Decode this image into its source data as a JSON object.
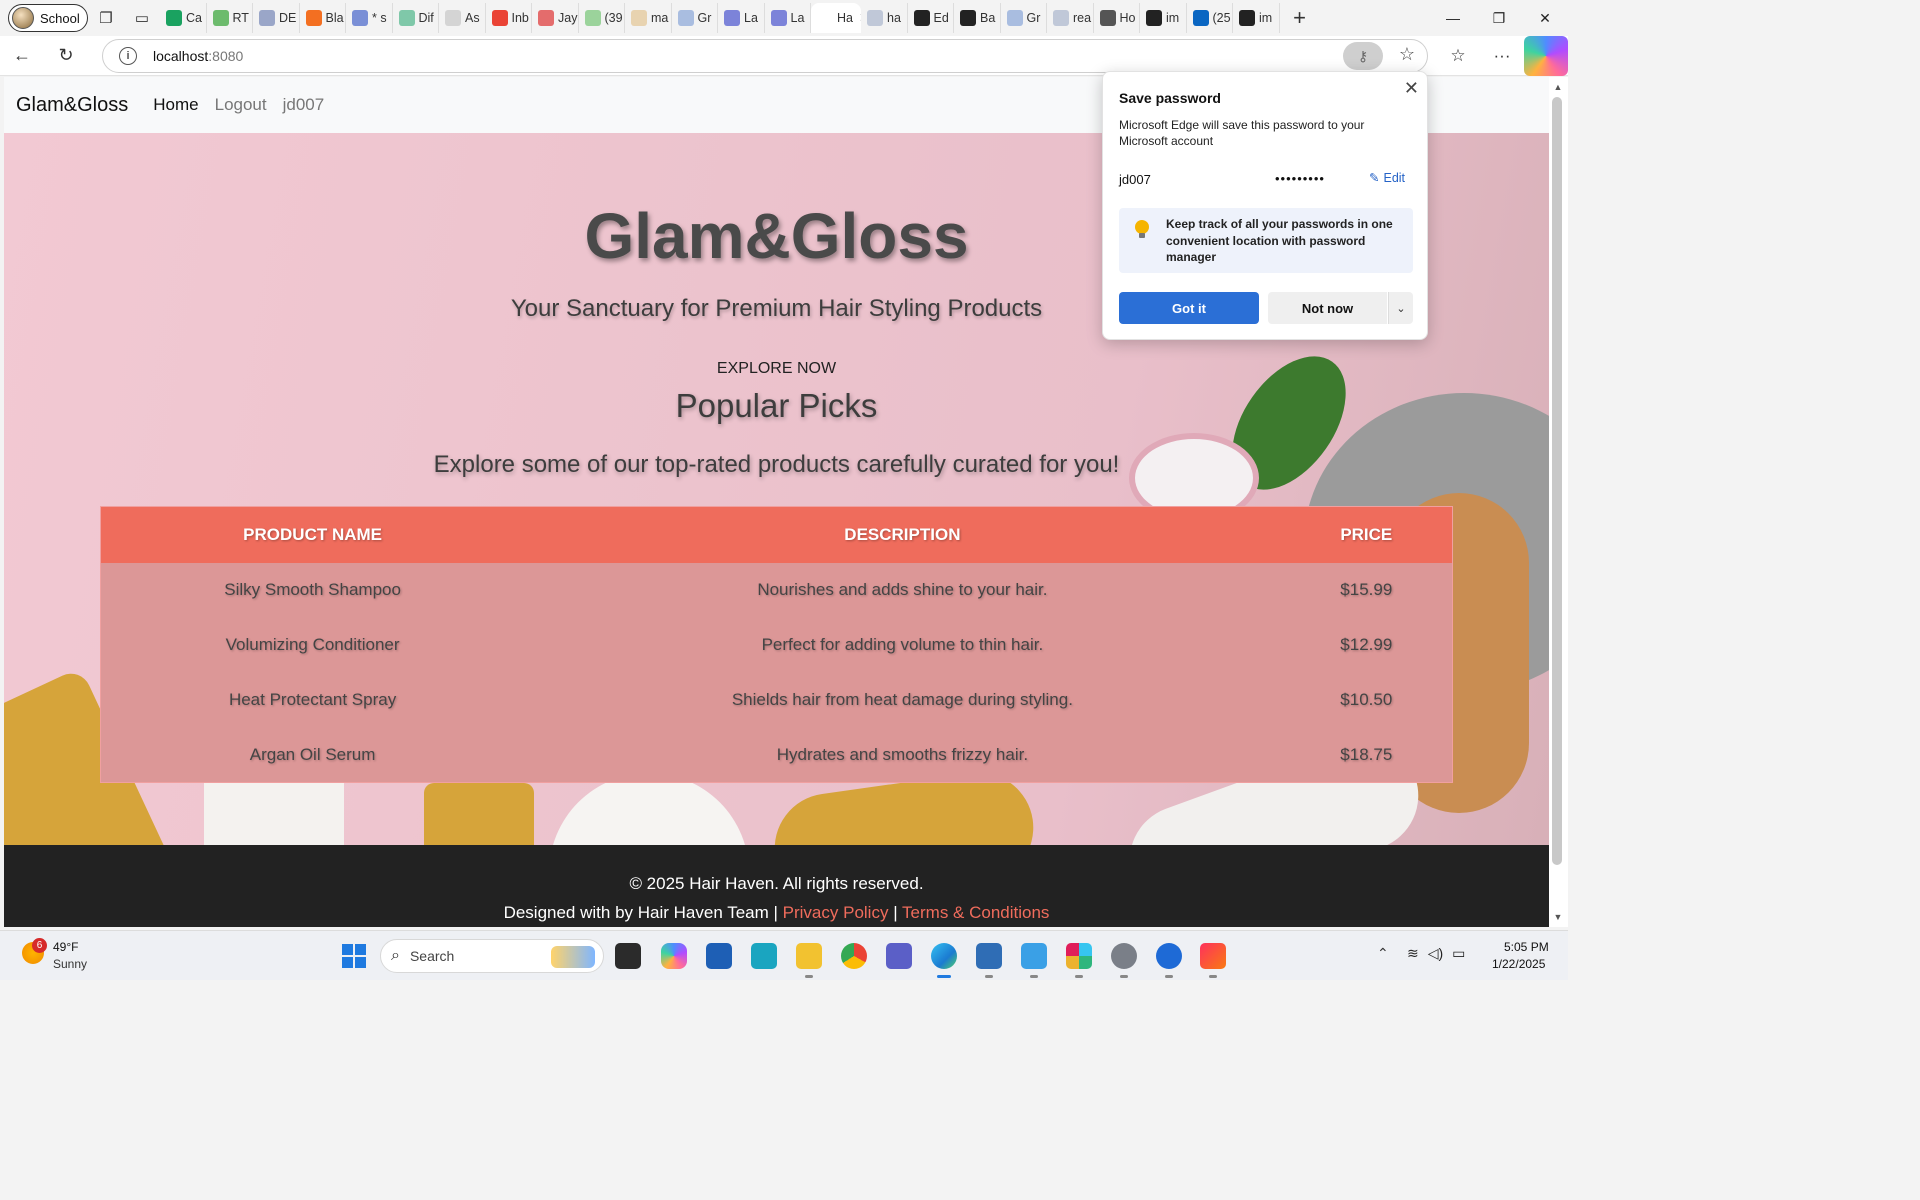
{
  "browser": {
    "profile_name": "School",
    "tabs": [
      {
        "label": "Ca",
        "color": "#1aa260"
      },
      {
        "label": "RT",
        "color": "#6dbb6d"
      },
      {
        "label": "DE",
        "color": "#9aa6c8"
      },
      {
        "label": "Bla",
        "color": "#f36f21"
      },
      {
        "label": "* s",
        "color": "#7a8fd6"
      },
      {
        "label": "Dif",
        "color": "#7fc8a9"
      },
      {
        "label": "As",
        "color": "#d4d4d4"
      },
      {
        "label": "Inb",
        "color": "#ea4335"
      },
      {
        "label": "Jay",
        "color": "#e46c6c"
      },
      {
        "label": "(39",
        "color": "#9bd39b"
      },
      {
        "label": "ma",
        "color": "#e8d3b0"
      },
      {
        "label": "Gr",
        "color": "#a9bde0"
      },
      {
        "label": "La",
        "color": "#7c83d9"
      },
      {
        "label": "La",
        "color": "#7c83d9"
      },
      {
        "label": "Ha",
        "color": "#ffffff"
      },
      {
        "label": "ha",
        "color": "#c0c8d8"
      },
      {
        "label": "Ed",
        "color": "#222222"
      },
      {
        "label": "Ba",
        "color": "#222222"
      },
      {
        "label": "Gr",
        "color": "#a9bde0"
      },
      {
        "label": "rea",
        "color": "#c0c8d8"
      },
      {
        "label": "Ho",
        "color": "#555555"
      },
      {
        "label": "im",
        "color": "#222222"
      },
      {
        "label": "(25",
        "color": "#0a66c2"
      },
      {
        "label": "im",
        "color": "#222222"
      }
    ],
    "url_host": "localhost",
    "url_port": ":8080"
  },
  "site": {
    "brand": "Glam&Gloss",
    "nav": {
      "home": "Home",
      "logout": "Logout",
      "user": "jd007"
    },
    "hero_title": "Glam&Gloss",
    "hero_subtitle": "Your Sanctuary for Premium Hair Styling Products",
    "explore_label": "EXPLORE NOW",
    "picks_title": "Popular Picks",
    "picks_subtitle": "Explore some of our top-rated products carefully curated for you!",
    "table": {
      "headers": [
        "PRODUCT NAME",
        "DESCRIPTION",
        "PRICE"
      ],
      "rows": [
        {
          "name": "Silky Smooth Shampoo",
          "description": "Nourishes and adds shine to your hair.",
          "price": "$15.99"
        },
        {
          "name": "Volumizing Conditioner",
          "description": "Perfect for adding volume to thin hair.",
          "price": "$12.99"
        },
        {
          "name": "Heat Protectant Spray",
          "description": "Shields hair from heat damage during styling.",
          "price": "$10.50"
        },
        {
          "name": "Argan Oil Serum",
          "description": "Hydrates and smooths frizzy hair.",
          "price": "$18.75"
        }
      ]
    },
    "footer": {
      "copyright": "© 2025 Hair Haven. All rights reserved.",
      "designed_by": "Designed with by Hair Haven Team",
      "separator": "|",
      "privacy": "Privacy Policy",
      "terms": "Terms & Conditions"
    }
  },
  "save_password_popup": {
    "title": "Save password",
    "description": "Microsoft Edge will save this password to your Microsoft account",
    "username": "jd007",
    "password_mask": "•••••••••",
    "edit_label": "Edit",
    "tip": "Keep track of all your passwords in one convenient location with password manager",
    "primary_button": "Got it",
    "secondary_button": "Not now"
  },
  "taskbar": {
    "weather_badge": "6",
    "weather_temp": "49°F",
    "weather_condition": "Sunny",
    "search_placeholder": "Search",
    "time": "5:05 PM",
    "date": "1/22/2025"
  },
  "colors": {
    "accent": "#ef6c5c",
    "table_body": "#dc9797",
    "footer_bg": "#222222",
    "edge_blue": "#2b6fd6"
  }
}
